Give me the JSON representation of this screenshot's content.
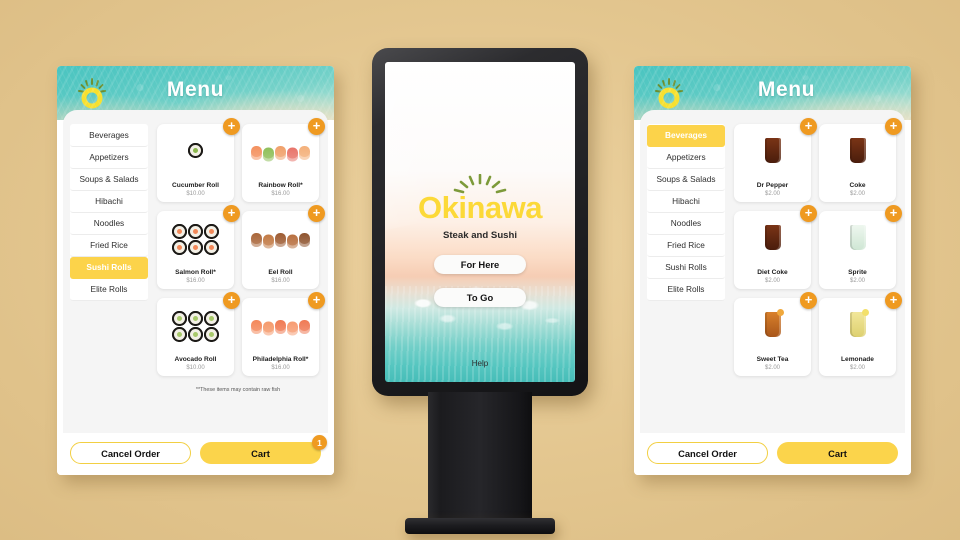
{
  "background_color": "#e6c994",
  "accent": {
    "yellow": "#fbd44b",
    "orange": "#ef9a21",
    "teal": "#55c6c0",
    "logo_yellow": "#fcd938"
  },
  "kiosk": {
    "brand": "Okinawa",
    "tagline": "Steak and Sushi",
    "logo_icon": "sun-logo-icon",
    "buttons": [
      {
        "label": "For Here",
        "name": "for-here-button"
      },
      {
        "label": "To Go",
        "name": "to-go-button"
      }
    ],
    "help_label": "Help"
  },
  "panel_left": {
    "header": {
      "title": "Menu",
      "logo_icon": "sun-logo-icon"
    },
    "categories": [
      {
        "label": "Beverages",
        "active": false
      },
      {
        "label": "Appetizers",
        "active": false
      },
      {
        "label": "Soups & Salads",
        "active": false
      },
      {
        "label": "Hibachi",
        "active": false
      },
      {
        "label": "Noodles",
        "active": false
      },
      {
        "label": "Fried Rice",
        "active": false
      },
      {
        "label": "Sushi Rolls",
        "active": true
      },
      {
        "label": "Elite Rolls",
        "active": false
      }
    ],
    "items": [
      {
        "name": "Cucumber Roll",
        "price": "$10.00",
        "art": "maki-cucumber"
      },
      {
        "name": "Rainbow Roll*",
        "price": "$16.00",
        "art": "rainbow"
      },
      {
        "name": "Salmon Roll*",
        "price": "$16.00",
        "art": "maki-salmon"
      },
      {
        "name": "Eel Roll",
        "price": "$16.00",
        "art": "eel"
      },
      {
        "name": "Avocado Roll",
        "price": "$10.00",
        "art": "maki-avocado"
      },
      {
        "name": "Philadelphia Roll*",
        "price": "$16.00",
        "art": "philly"
      }
    ],
    "footnote": "**These items may contain raw fish",
    "add_icon": "plus-icon",
    "actions": {
      "cancel_label": "Cancel Order",
      "cart_label": "Cart",
      "cart_badge": "1"
    }
  },
  "panel_right": {
    "header": {
      "title": "Menu",
      "logo_icon": "sun-logo-icon"
    },
    "categories": [
      {
        "label": "Beverages",
        "active": true
      },
      {
        "label": "Appetizers",
        "active": false
      },
      {
        "label": "Soups & Salads",
        "active": false
      },
      {
        "label": "Hibachi",
        "active": false
      },
      {
        "label": "Noodles",
        "active": false
      },
      {
        "label": "Fried Rice",
        "active": false
      },
      {
        "label": "Sushi Rolls",
        "active": false
      },
      {
        "label": "Elite Rolls",
        "active": false
      }
    ],
    "items": [
      {
        "name": "Dr Pepper",
        "price": "$2.00",
        "art": "cola"
      },
      {
        "name": "Coke",
        "price": "$2.00",
        "art": "cola"
      },
      {
        "name": "Diet Coke",
        "price": "$2.00",
        "art": "cola"
      },
      {
        "name": "Sprite",
        "price": "$2.00",
        "art": "clear"
      },
      {
        "name": "Sweet Tea",
        "price": "$2.00",
        "art": "tea"
      },
      {
        "name": "Lemonade",
        "price": "$2.00",
        "art": "lemonade"
      }
    ],
    "footnote": "",
    "add_icon": "plus-icon",
    "actions": {
      "cancel_label": "Cancel Order",
      "cart_label": "Cart",
      "cart_badge": ""
    }
  }
}
